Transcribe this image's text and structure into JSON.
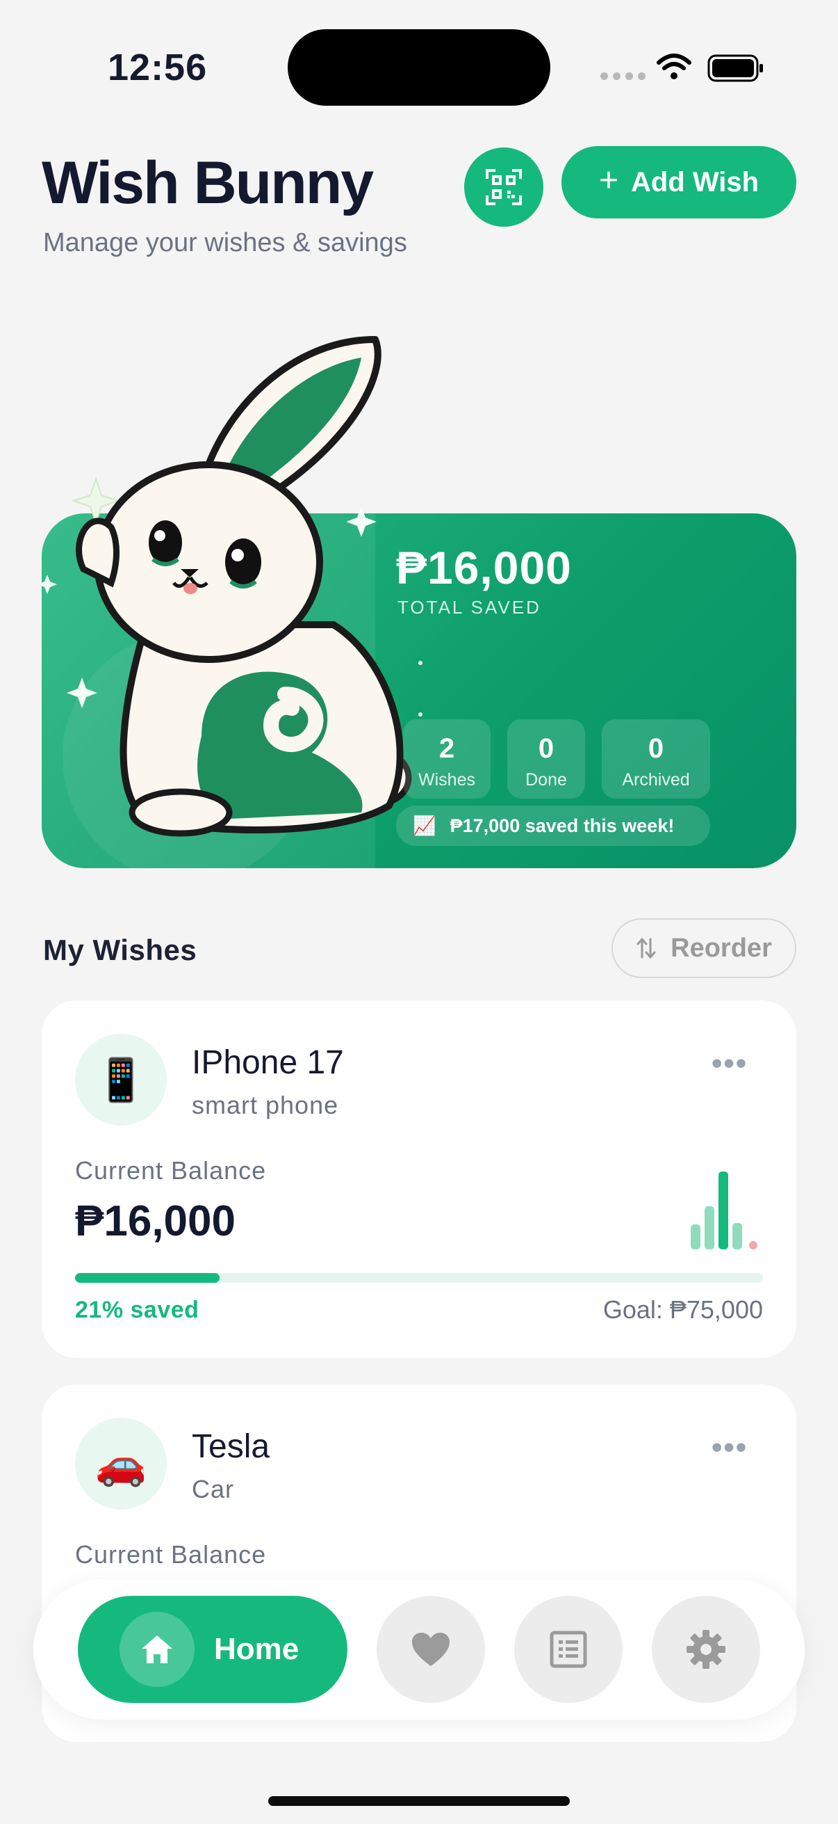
{
  "status_bar": {
    "time": "12:56"
  },
  "header": {
    "title": "Wish Bunny",
    "subtitle": "Manage your wishes & savings",
    "add_button_label": "Add Wish"
  },
  "summary": {
    "total_amount": "₱16,000",
    "total_label": "TOTAL SAVED",
    "stats": [
      {
        "value": "2",
        "label": "Wishes"
      },
      {
        "value": "0",
        "label": "Done"
      },
      {
        "value": "0",
        "label": "Archived"
      }
    ],
    "weekly_icon": "📈",
    "weekly_text": "₱17,000 saved this week!"
  },
  "wishes_section": {
    "title": "My Wishes",
    "reorder_label": "Reorder"
  },
  "wishes": [
    {
      "icon": "📱",
      "name": "IPhone 17",
      "category": "smart phone",
      "balance_label": "Current Balance",
      "balance": "₱16,000",
      "progress_fraction": 0.21,
      "percent_label": "21% saved",
      "goal_label": "Goal: ₱75,000"
    },
    {
      "icon": "🚗",
      "name": "Tesla",
      "category": "Car",
      "balance_label": "Current Balance"
    }
  ],
  "nav": {
    "home_label": "Home",
    "items": [
      "home-icon",
      "heart-icon",
      "list-icon",
      "gear-icon"
    ]
  },
  "colors": {
    "accent": "#15b97d",
    "hero_gradient_start": "#27b783",
    "hero_gradient_end": "#079165",
    "muted_text": "#6b7280"
  }
}
